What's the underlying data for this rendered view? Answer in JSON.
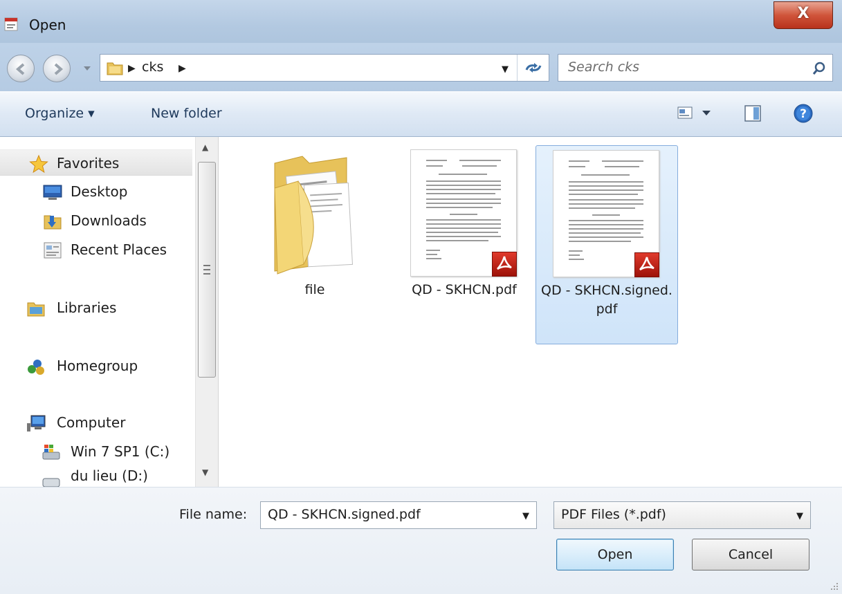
{
  "window": {
    "title": "Open",
    "close_symbol": "X"
  },
  "address": {
    "path": [
      "cks"
    ],
    "search_placeholder": "Search cks"
  },
  "toolbar": {
    "organize_label": "Organize ▾",
    "new_folder_label": "New folder"
  },
  "sidebar": {
    "items": [
      {
        "label": "Favorites",
        "icon": "star-icon"
      },
      {
        "label": "Desktop",
        "icon": "desktop-icon"
      },
      {
        "label": "Downloads",
        "icon": "downloads-icon"
      },
      {
        "label": "Recent Places",
        "icon": "recent-places-icon"
      },
      {
        "label": "Libraries",
        "icon": "libraries-icon"
      },
      {
        "label": "Homegroup",
        "icon": "homegroup-icon"
      },
      {
        "label": "Computer",
        "icon": "computer-icon"
      },
      {
        "label": "Win 7 SP1 (C:)",
        "icon": "drive-c-icon"
      },
      {
        "label": "du lieu (D:)",
        "icon": "drive-d-icon"
      }
    ]
  },
  "files": [
    {
      "name": "file",
      "type": "folder",
      "selected": false
    },
    {
      "name": "QD - SKHCN.pdf",
      "type": "pdf",
      "selected": false
    },
    {
      "name": "QD - SKHCN.signed.pdf",
      "type": "pdf",
      "selected": true
    }
  ],
  "bottom": {
    "file_name_label": "File name:",
    "file_name_value": "QD - SKHCN.signed.pdf",
    "file_type_value": "PDF Files (*.pdf)",
    "open_label": "Open",
    "cancel_label": "Cancel"
  },
  "colors": {
    "selection": "#cfe4f9",
    "pdf_badge": "#c41e12",
    "close_button": "#d0553b"
  }
}
